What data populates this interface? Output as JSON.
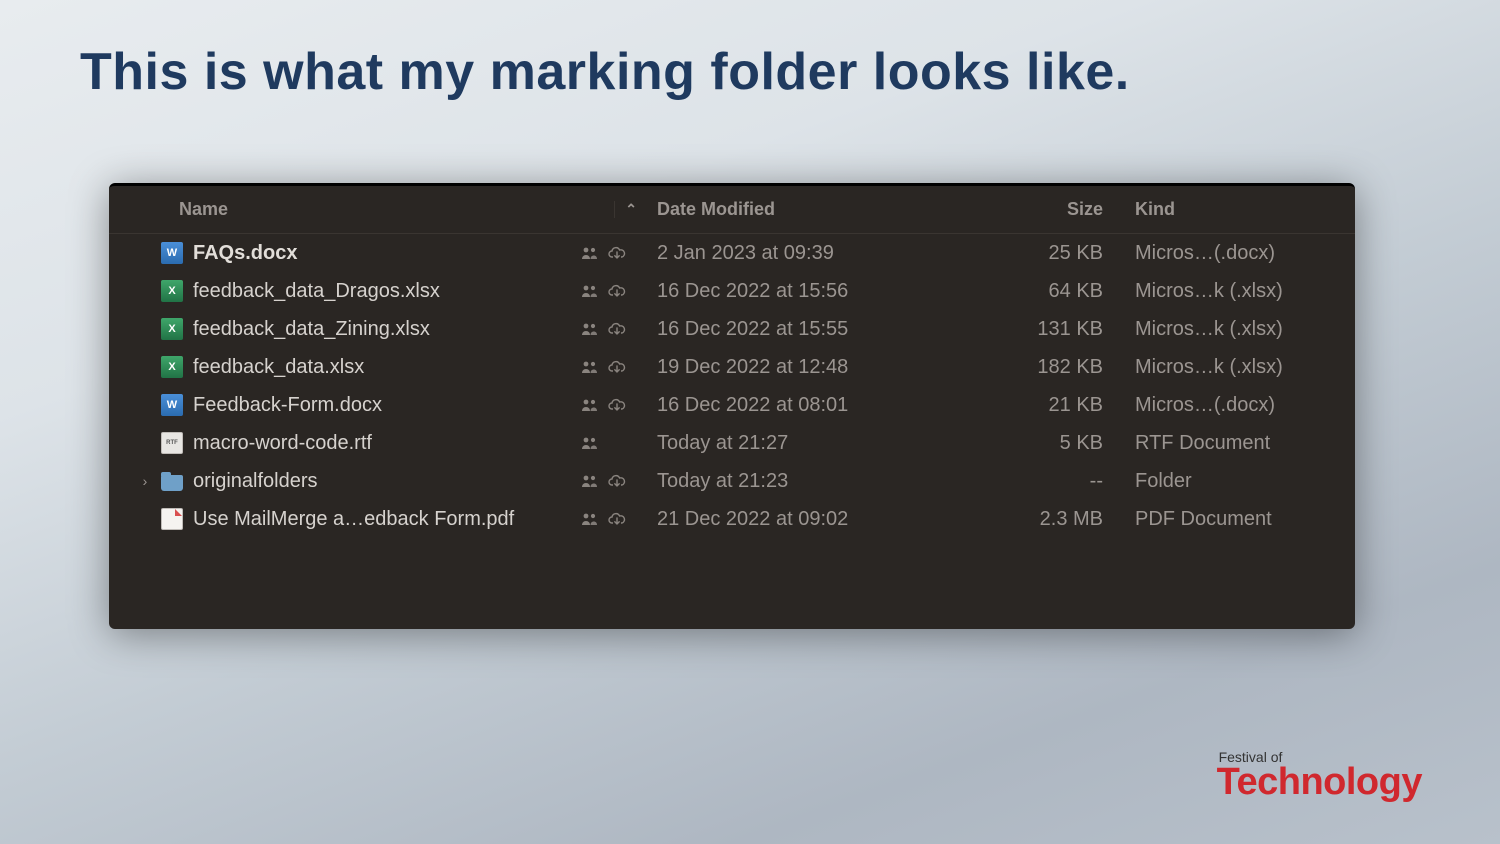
{
  "slide": {
    "title": "This is what my marking folder looks like."
  },
  "columns": {
    "name": "Name",
    "date": "Date Modified",
    "size": "Size",
    "kind": "Kind"
  },
  "files": [
    {
      "icon": "docx",
      "name": "FAQs.docx",
      "shared": true,
      "cloud": true,
      "date": "2 Jan 2023 at 09:39",
      "size": "25 KB",
      "kind": "Micros…(.docx)",
      "bold": true,
      "expandable": false
    },
    {
      "icon": "xlsx",
      "name": "feedback_data_Dragos.xlsx",
      "shared": true,
      "cloud": true,
      "date": "16 Dec 2022 at 15:56",
      "size": "64 KB",
      "kind": "Micros…k (.xlsx)",
      "bold": false,
      "expandable": false
    },
    {
      "icon": "xlsx",
      "name": "feedback_data_Zining.xlsx",
      "shared": true,
      "cloud": true,
      "date": "16 Dec 2022 at 15:55",
      "size": "131 KB",
      "kind": "Micros…k (.xlsx)",
      "bold": false,
      "expandable": false
    },
    {
      "icon": "xlsx",
      "name": "feedback_data.xlsx",
      "shared": true,
      "cloud": true,
      "date": "19 Dec 2022 at 12:48",
      "size": "182 KB",
      "kind": "Micros…k (.xlsx)",
      "bold": false,
      "expandable": false
    },
    {
      "icon": "docx",
      "name": "Feedback-Form.docx",
      "shared": true,
      "cloud": true,
      "date": "16 Dec 2022 at 08:01",
      "size": "21 KB",
      "kind": "Micros…(.docx)",
      "bold": false,
      "expandable": false
    },
    {
      "icon": "rtf",
      "name": "macro-word-code.rtf",
      "shared": true,
      "cloud": false,
      "date": "Today at 21:27",
      "size": "5 KB",
      "kind": "RTF Document",
      "bold": false,
      "expandable": false
    },
    {
      "icon": "folder",
      "name": "originalfolders",
      "shared": true,
      "cloud": true,
      "date": "Today at 21:23",
      "size": "--",
      "kind": "Folder",
      "bold": false,
      "expandable": true
    },
    {
      "icon": "pdf",
      "name": "Use MailMerge a…edback Form.pdf",
      "shared": true,
      "cloud": true,
      "date": "21 Dec 2022 at 09:02",
      "size": "2.3 MB",
      "kind": "PDF Document",
      "bold": false,
      "expandable": false
    }
  ],
  "logo": {
    "top": "Festival of",
    "bottom": "Technology"
  }
}
